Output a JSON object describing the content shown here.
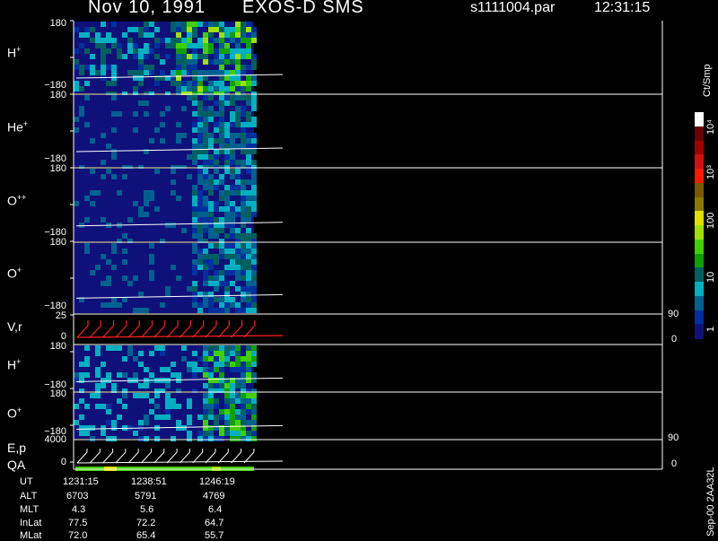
{
  "header": {
    "date": "Nov 10, 1991",
    "instrument": "EXOS-D SMS",
    "file": "s1111004.par",
    "time": "12:31:15"
  },
  "panels": [
    {
      "label_main": "H",
      "label_sup": "+",
      "ticks": [
        "180",
        "−180"
      ]
    },
    {
      "label_main": "He",
      "label_sup": "+",
      "ticks": [
        "180",
        "−180"
      ]
    },
    {
      "label_main": "O",
      "label_sup": "++",
      "ticks": [
        "180",
        "−180"
      ]
    },
    {
      "label_main": "O",
      "label_sup": "+",
      "ticks": [
        "180",
        "−180"
      ]
    },
    {
      "label_main": "V,r",
      "label_sup": "",
      "ticks": [
        "25",
        "0"
      ],
      "right_ticks": [
        "90",
        "0"
      ]
    },
    {
      "label_main": "H",
      "label_sup": "+",
      "ticks": [
        "180",
        "−180"
      ]
    },
    {
      "label_main": "O",
      "label_sup": "+",
      "ticks": [
        "180",
        "−180"
      ]
    },
    {
      "label_main": "E,p",
      "label_sup": "",
      "ticks": [
        "4000",
        "0"
      ],
      "right_ticks": [
        "90",
        "0"
      ]
    }
  ],
  "qa_label": "QA",
  "ephemeris": {
    "rows": [
      {
        "name": "UT",
        "values": [
          "1231:15",
          "1238:51",
          "1246:19"
        ]
      },
      {
        "name": "ALT",
        "values": [
          "6703",
          "5791",
          "4769"
        ]
      },
      {
        "name": "MLT",
        "values": [
          "4.3",
          "5.6",
          "6.4"
        ]
      },
      {
        "name": "InLat",
        "values": [
          "77.5",
          "72.2",
          "64.7"
        ]
      },
      {
        "name": "MLat",
        "values": [
          "72.0",
          "65.4",
          "55.7"
        ]
      }
    ]
  },
  "colorbar": {
    "unit": "Ct/Smp",
    "labels": [
      "10⁴",
      "10³",
      "100",
      "10",
      "1"
    ],
    "colors": [
      "#ffffff",
      "#6a0000",
      "#a00000",
      "#d01010",
      "#ff1a00",
      "#7a5a00",
      "#8a7a00",
      "#e0e000",
      "#a0e000",
      "#40d000",
      "#10a000",
      "#006060",
      "#00b0c0",
      "#006090",
      "#0030a0",
      "#10107a"
    ]
  },
  "footer": "Sep-00  2AA32L",
  "chart_data": {
    "type": "heatmap",
    "title": "Nov 10, 1991   EXOS-D SMS",
    "x_ticks": [
      "1231:15",
      "1238:51",
      "1246:19"
    ],
    "panels": [
      "H+",
      "He+",
      "O++",
      "O+",
      "V,r",
      "H+",
      "O+",
      "E,p"
    ],
    "y_ranges": [
      [
        -180,
        180
      ],
      [
        -180,
        180
      ],
      [
        -180,
        180
      ],
      [
        -180,
        180
      ],
      [
        0,
        25
      ],
      [
        -180,
        180
      ],
      [
        -180,
        180
      ],
      [
        0,
        4000
      ]
    ],
    "colorbar_unit": "Ct/Smp",
    "colorbar_ticks": [
      "1",
      "10",
      "100",
      "10³",
      "10⁴"
    ]
  }
}
